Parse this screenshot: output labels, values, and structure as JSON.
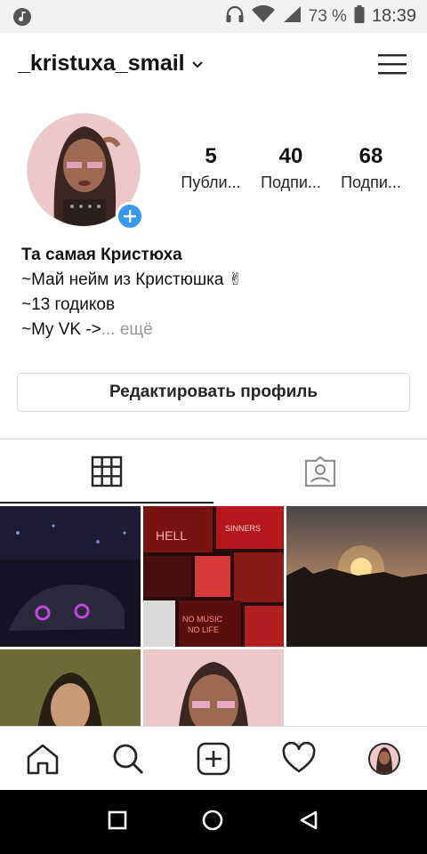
{
  "status_bar": {
    "battery": "73 %",
    "time": "18:39"
  },
  "header": {
    "username": "_kristuxa_smail"
  },
  "stats": [
    {
      "num": "5",
      "label": "Публи..."
    },
    {
      "num": "40",
      "label": "Подпи..."
    },
    {
      "num": "68",
      "label": "Подпи..."
    }
  ],
  "bio": {
    "name": "Та самая Кристюха",
    "line1": "~Май нейм из Кристюшка ✌",
    "line2": "~13 годиков",
    "line3": "~My VK ->",
    "more": "... ещё"
  },
  "edit_button": "Редактировать профиль",
  "colors": {
    "accent": "#3897f0",
    "border": "#dbdbdb",
    "text": "#262626"
  }
}
